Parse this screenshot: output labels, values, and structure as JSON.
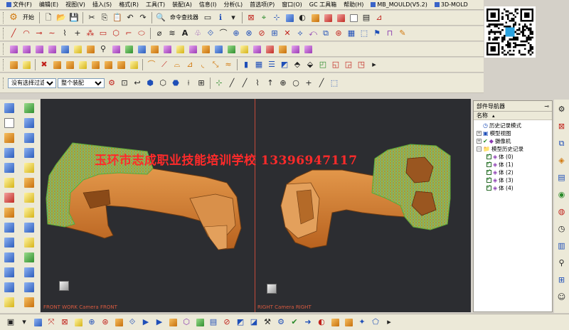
{
  "menu": {
    "items": [
      "文件(F)",
      "编辑(E)",
      "视图(V)",
      "插入(S)",
      "格式(R)",
      "工具(T)",
      "装配(A)",
      "信息(I)",
      "分析(L)",
      "首选项(P)",
      "窗口(O)",
      "GC 工具箱",
      "帮助(H)",
      "MB_MOULD(V5.2)",
      "3D-MOLD"
    ]
  },
  "toolbar": {
    "start_label": "开始",
    "command_finder_label": "命令查找器",
    "filter_select_value": "没有选择过滤器",
    "assembly_select_value": "整个装配"
  },
  "viewport": {
    "watermark": "玉环市志成职业技能培训学校  13396947117",
    "left_view_label": "FRONT WORK Camera FRONT",
    "right_view_label": "RIGHT Camera RIGHT"
  },
  "navigator": {
    "title": "部件导航器",
    "column_name": "名称",
    "items": [
      {
        "label": "历史记录模式",
        "level": 0
      },
      {
        "label": "模型视图",
        "level": 0
      },
      {
        "label": "摄像机",
        "level": 0
      },
      {
        "label": "模型历史记录",
        "level": 0
      },
      {
        "label": "体 (0)",
        "level": 1
      },
      {
        "label": "体 (1)",
        "level": 1
      },
      {
        "label": "体 (2)",
        "level": 1
      },
      {
        "label": "体 (3)",
        "level": 1
      },
      {
        "label": "体 (4)",
        "level": 1
      }
    ]
  },
  "colors": {
    "viewport_bg": "#2c2d31",
    "part_orange": "#d98a3c",
    "mesh_green": "#6fd04a",
    "watermark_red": "#ff2a2a"
  }
}
